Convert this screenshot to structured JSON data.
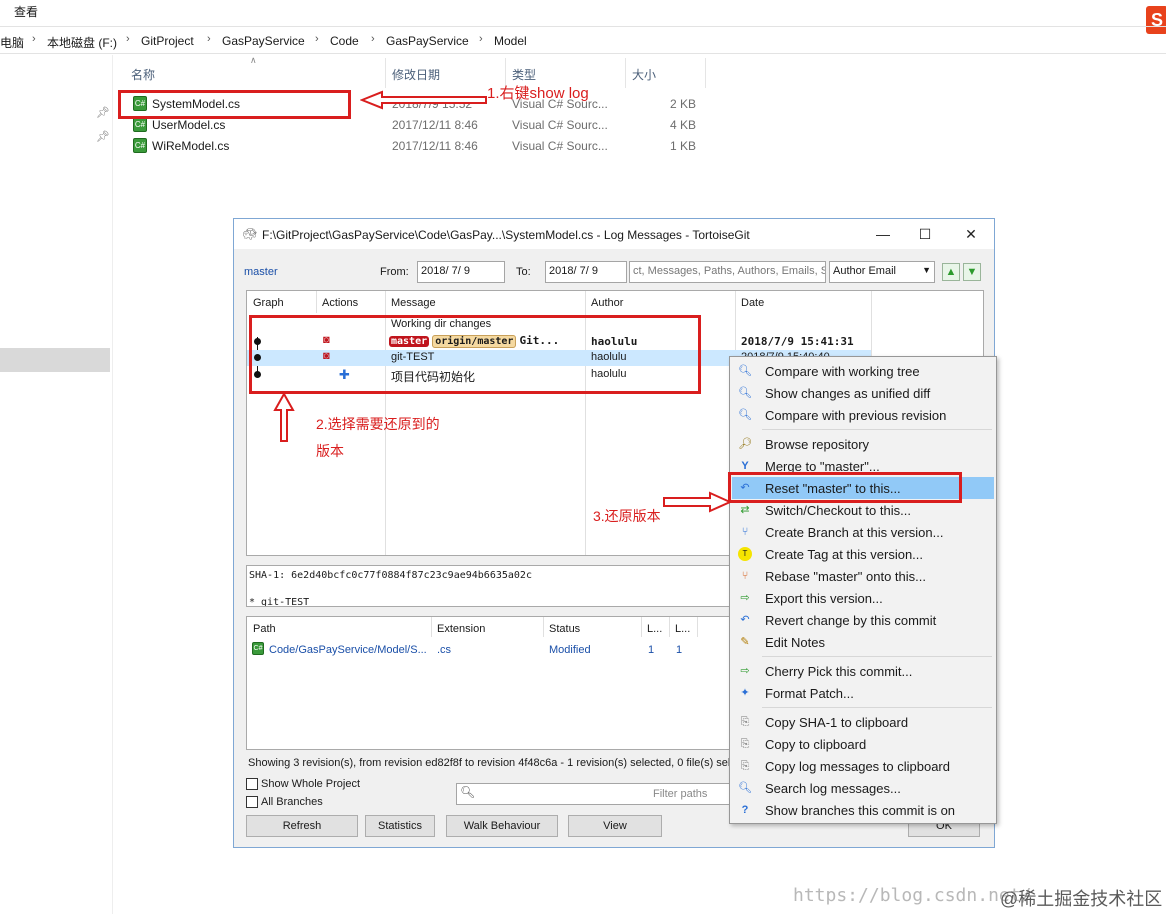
{
  "explorer": {
    "ribbon_view": "查看",
    "breadcrumb": [
      "电脑",
      "本地磁盘 (F:)",
      "GitProject",
      "GasPayService",
      "Code",
      "GasPayService",
      "Model"
    ],
    "columns": {
      "name": "名称",
      "modified": "修改日期",
      "type": "类型",
      "size": "大小"
    },
    "files": [
      {
        "name": "SystemModel.cs",
        "modified": "2018/7/9 15:52",
        "type": "Visual C# Sourc...",
        "size": "2 KB"
      },
      {
        "name": "UserModel.cs",
        "modified": "2017/12/11 8:46",
        "type": "Visual C# Sourc...",
        "size": "4 KB"
      },
      {
        "name": "WiReModel.cs",
        "modified": "2017/12/11 8:46",
        "type": "Visual C# Sourc...",
        "size": "1 KB"
      }
    ]
  },
  "annotations": {
    "step1": "1.右键show log",
    "step2_line1": "2.选择需要还原到的",
    "step2_line2": "版本",
    "step3": "3.还原版本"
  },
  "dialog": {
    "title": "F:\\GitProject\\GasPayService\\Code\\GasPay...\\SystemModel.cs - Log Messages - TortoiseGit",
    "branch": "master",
    "from_label": "From:",
    "from_value": "2018/ 7/ 9",
    "to_label": "To:",
    "to_value": "2018/ 7/ 9",
    "search_placeholder": "ct, Messages, Paths, Authors, Emails, S",
    "filter_select": "Author Email",
    "log_columns": {
      "graph": "Graph",
      "actions": "Actions",
      "message": "Message",
      "author": "Author",
      "date": "Date"
    },
    "log_rows": [
      {
        "message": "Working dir changes",
        "author": "",
        "date": ""
      },
      {
        "tag1": "master",
        "tag2": "origin/master",
        "message": "Git...",
        "author": "haolulu",
        "date": "2018/7/9 15:41:31"
      },
      {
        "message": "git-TEST",
        "author": "haolulu",
        "date": "2018/7/9 15:40:40"
      },
      {
        "message": "项目代码初始化",
        "author": "haolulu",
        "date": ""
      }
    ],
    "sha_line": "SHA-1: 6e2d40bcfc0c77f0884f87c23c9ae94b6635a02c",
    "commit_msg": "* git-TEST",
    "file_columns": {
      "path": "Path",
      "extension": "Extension",
      "status": "Status",
      "l1": "L...",
      "l2": "L..."
    },
    "file_rows": [
      {
        "path": "Code/GasPayService/Model/S...",
        "extension": ".cs",
        "status": "Modified",
        "l1": "1",
        "l2": "1"
      }
    ],
    "status_line": "Showing 3 revision(s), from revision ed82f8f to revision 4f48c6a - 1 revision(s) selected, 0 file(s) sele",
    "show_whole_project": "Show Whole Project",
    "all_branches": "All Branches",
    "filter_paths": "Filter paths",
    "buttons": {
      "refresh": "Refresh",
      "statistics": "Statistics",
      "walk": "Walk Behaviour",
      "view": "View",
      "ok": "OK"
    }
  },
  "context_menu": {
    "group1": [
      "Compare with working tree",
      "Show changes as unified diff",
      "Compare with previous revision"
    ],
    "group2": [
      "Browse repository",
      "Merge to \"master\"...",
      "Reset \"master\" to this...",
      "Switch/Checkout to this...",
      "Create Branch at this version...",
      "Create Tag at this version...",
      "Rebase \"master\" onto this...",
      "Export this version...",
      "Revert change by this commit",
      "Edit Notes"
    ],
    "group3": [
      "Cherry Pick this commit...",
      "Format Patch..."
    ],
    "group4": [
      "Copy SHA-1 to clipboard",
      "Copy to clipboard",
      "Copy log messages to clipboard",
      "Search log messages...",
      "Show branches this commit is on"
    ]
  },
  "watermark": {
    "url": "https://blog.csdn.net/",
    "community": "@稀土掘金技术社区"
  }
}
